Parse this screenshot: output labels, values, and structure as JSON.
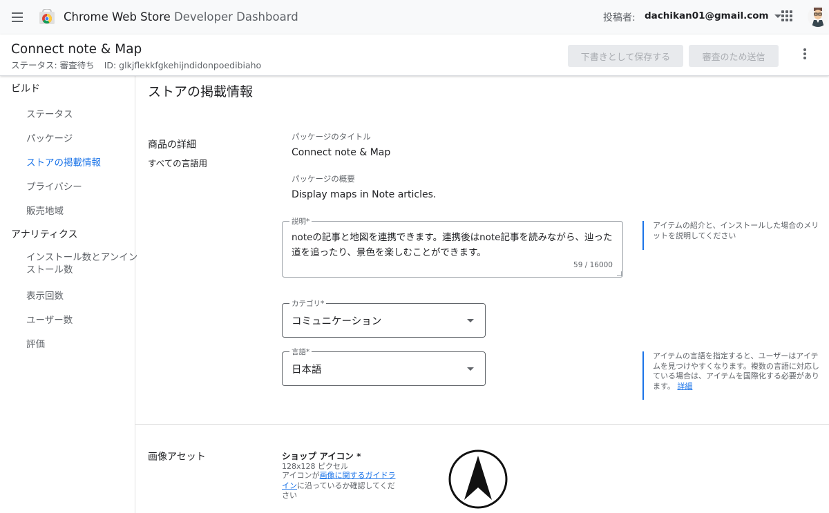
{
  "appbar": {
    "title_main": "Chrome Web Store",
    "title_sub": " Developer Dashboard",
    "publisher_label": "投稿者:",
    "account_email": "dachikan01@gmail.com"
  },
  "header": {
    "item_name": "Connect note & Map",
    "status": "ステータス: 審査待ち",
    "item_id": "ID: glkjflekkfgkehijndidonpoedibiaho",
    "save_draft": "下書きとして保存する",
    "submit_review": "審査のため送信"
  },
  "sidebar": {
    "build_section": "ビルド",
    "build_items": [
      "ステータス",
      "パッケージ",
      "ストアの掲載情報",
      "プライバシー",
      "販売地域"
    ],
    "analytics_section": "アナリティクス",
    "analytics_items": [
      "インストール数とアンイン",
      "ストール数",
      "表示回数",
      "ユーザー数",
      "評価"
    ],
    "active_item": "ストアの掲載情報"
  },
  "main": {
    "page_title": "ストアの掲載情報",
    "product_details": {
      "title": "商品の詳細",
      "subtitle": "すべての言語用",
      "package_title_label": "パッケージのタイトル",
      "package_title_value": "Connect note & Map",
      "package_summary_label": "パッケージの概要",
      "package_summary_value": "Display maps in Note articles.",
      "description_label": "説明*",
      "description_value": "noteの記事と地図を連携できます。連携後はnote記事を読みながら、辿った道を追ったり、景色を楽しむことができます。",
      "description_counter": "59 / 16000",
      "description_help": "アイテムの紹介と、インストールした場合のメリットを説明してください",
      "category_label": "カテゴリ*",
      "category_value": "コミュニケーション",
      "language_label": "言語*",
      "language_value": "日本語",
      "language_help": "アイテムの言語を指定すると、ユーザーはアイテムを見つけやすくなります。複数の言語に対応している場合は、アイテムを国際化する必要があります。",
      "language_help_link": "詳細"
    },
    "image_assets": {
      "title": "画像アセット",
      "shop_icon_title": "ショップ アイコン *",
      "shop_icon_size": "128x128 ピクセル",
      "guide_prefix": "アイコンが",
      "guide_link": "画像に関するガイドライン",
      "guide_suffix": "に沿っているか確認してください"
    }
  },
  "colors": {
    "accent": "#1a73e8",
    "appbar_bg": "#f8f9fa",
    "disabled_button_bg": "#e8eaed"
  }
}
